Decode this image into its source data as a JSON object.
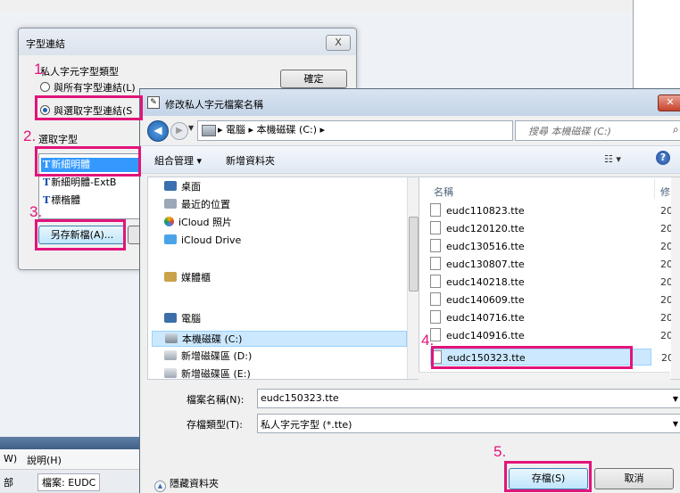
{
  "font_link_dialog": {
    "title": "字型連結",
    "close_label": "X",
    "private_font_type_label": "私人字元字型類型",
    "radio_link_all": "與所有字型連結(L)",
    "radio_link_selected": "與選取字型連結(S",
    "ok_label": "確定",
    "select_font_label": "選取字型",
    "fonts": [
      "新細明體",
      "新細明體-ExtB",
      "標楷體"
    ],
    "font_icon": "T",
    "save_as_label": "另存新檔(A)..."
  },
  "background_menu": {
    "menu_items": [
      "W)",
      "說明(H)"
    ],
    "status_left": "部",
    "status_file": "檔案: EUDC"
  },
  "save_dialog": {
    "title": "修改私人字元檔案名稱",
    "close_label": "✕",
    "breadcrumbs": "▸ 電腦 ▸ 本機磁碟 (C:) ▸",
    "search_placeholder": "搜尋 本機磁碟 (C:)",
    "organize_label": "組合管理 ▾",
    "new_folder_label": "新增資料夾",
    "help_label": "?",
    "nav_items": [
      {
        "label": "桌面",
        "icon": "desktop-icon"
      },
      {
        "label": "最近的位置",
        "icon": "recent-places-icon"
      },
      {
        "label": "iCloud 照片",
        "icon": "icloud-photos-icon"
      },
      {
        "label": "iCloud Drive",
        "icon": "icloud-drive-icon"
      },
      {
        "label": "媒體櫃",
        "icon": "libraries-icon"
      },
      {
        "label": "電腦",
        "icon": "computer-icon"
      },
      {
        "label": "本機磁碟 (C:)",
        "icon": "drive-icon"
      },
      {
        "label": "新增磁碟區 (D:)",
        "icon": "drive-icon"
      },
      {
        "label": "新增磁碟區 (E:)",
        "icon": "drive-icon"
      }
    ],
    "columns": {
      "name": "名稱",
      "modified": "修"
    },
    "files": [
      {
        "name": "eudc110823.tte",
        "date": "20"
      },
      {
        "name": "eudc120120.tte",
        "date": "20"
      },
      {
        "name": "eudc130516.tte",
        "date": "20"
      },
      {
        "name": "eudc130807.tte",
        "date": "20"
      },
      {
        "name": "eudc140218.tte",
        "date": "20"
      },
      {
        "name": "eudc140609.tte",
        "date": "20"
      },
      {
        "name": "eudc140716.tte",
        "date": "20"
      },
      {
        "name": "eudc140916.tte",
        "date": "20"
      },
      {
        "name": "eudc150323.tte",
        "date": "20"
      }
    ],
    "filename_label": "檔案名稱(N):",
    "filename_value": "eudc150323.tte",
    "filetype_label": "存檔類型(T):",
    "filetype_value": "私人字元字型 (*.tte)",
    "hide_folders_label": "隱藏資料夾",
    "save_label": "存檔(S)",
    "cancel_label": "取消"
  },
  "annotations": [
    "1.",
    "2.",
    "3.",
    "4.",
    "5."
  ],
  "colors": {
    "highlight": "#e2147a",
    "selection": "#3399ff",
    "selected_row": "#cce8ff"
  }
}
